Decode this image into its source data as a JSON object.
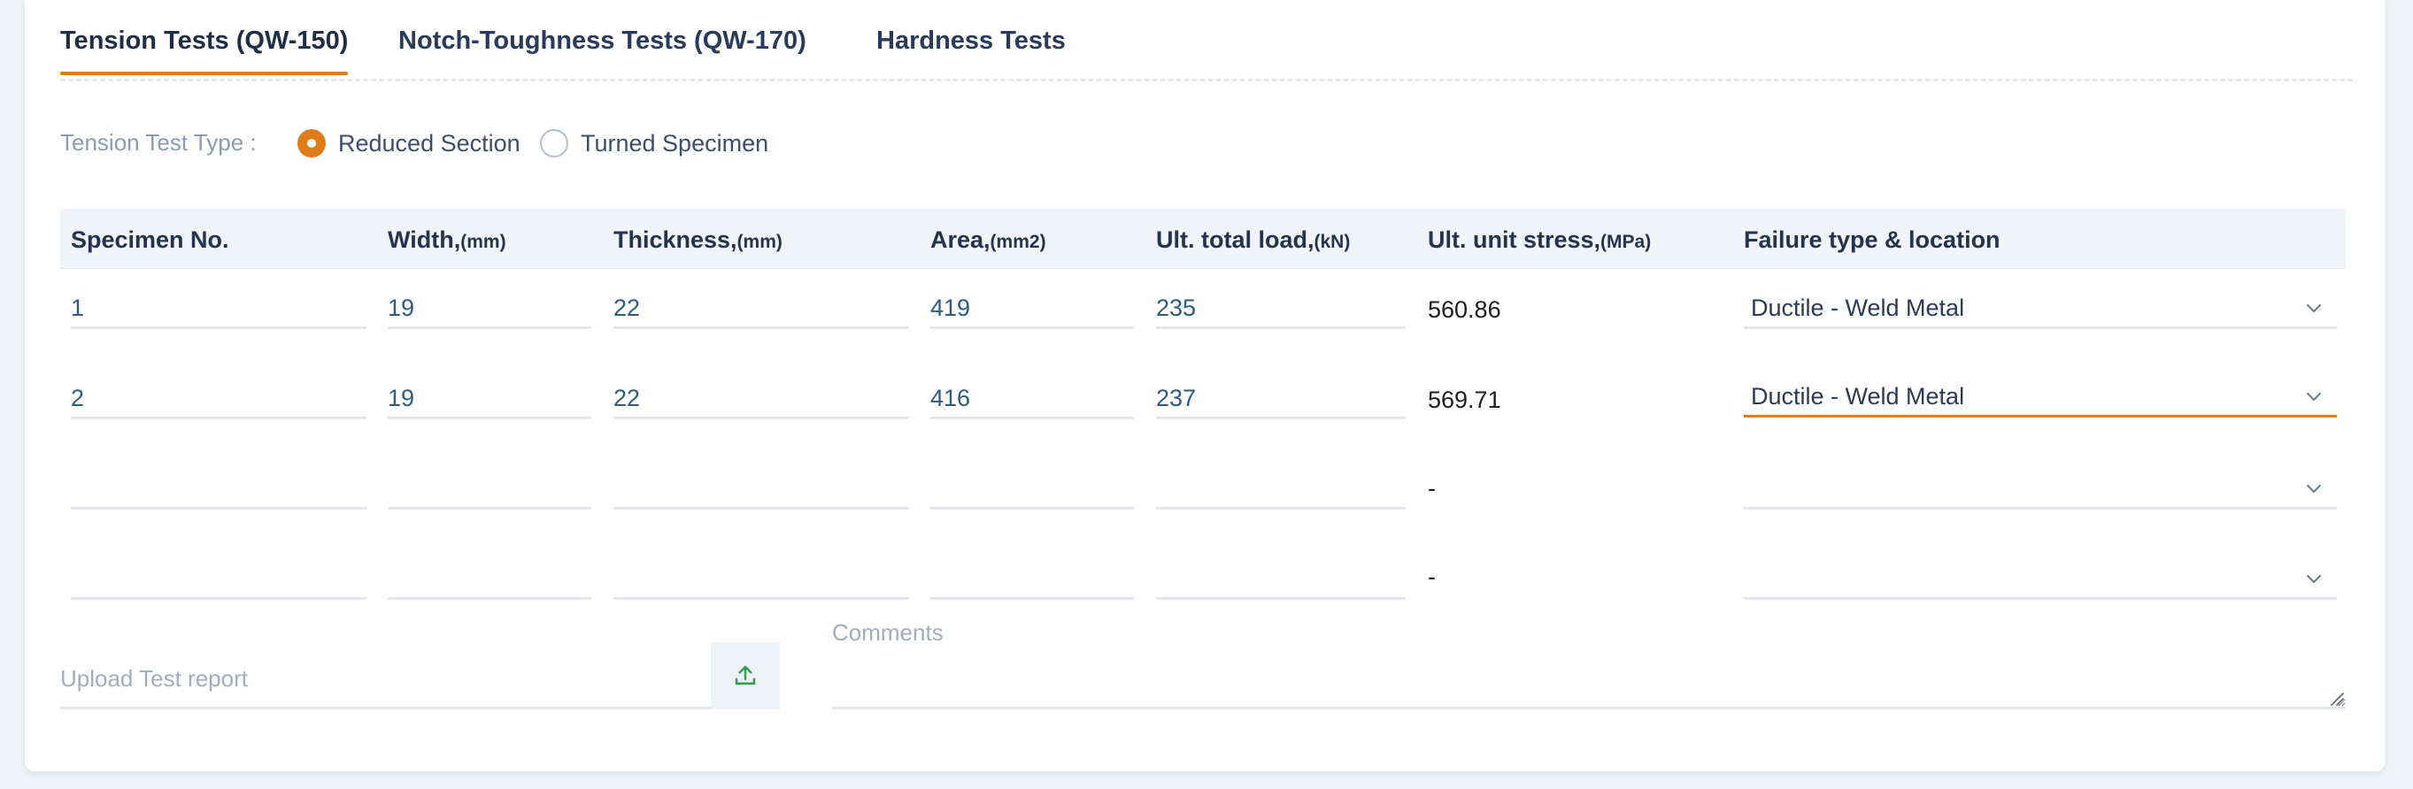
{
  "tabs": [
    {
      "label": "Tension Tests (QW-150)",
      "active": true
    },
    {
      "label": "Notch-Toughness Tests (QW-170)",
      "active": false
    },
    {
      "label": "Hardness Tests",
      "active": false
    }
  ],
  "tension_type": {
    "label": "Tension Test Type :",
    "options": [
      "Reduced Section",
      "Turned Specimen"
    ],
    "selected": "Reduced Section"
  },
  "table": {
    "headers": [
      {
        "title": "Specimen No.",
        "unit": ""
      },
      {
        "title": "Width,",
        "unit": "(mm)"
      },
      {
        "title": "Thickness,",
        "unit": "(mm)"
      },
      {
        "title": "Area,",
        "unit": "(mm2)"
      },
      {
        "title": "Ult. total load,",
        "unit": "(kN)"
      },
      {
        "title": "Ult. unit stress,",
        "unit": "(MPa)"
      },
      {
        "title": "Failure type & location",
        "unit": ""
      }
    ],
    "rows": [
      {
        "specimen": "1",
        "width": "19",
        "thickness": "22",
        "area": "419",
        "load": "235",
        "stress": "560.86",
        "failure": "Ductile - Weld Metal"
      },
      {
        "specimen": "2",
        "width": "19",
        "thickness": "22",
        "area": "416",
        "load": "237",
        "stress": "569.71",
        "failure": "Ductile - Weld Metal"
      },
      {
        "specimen": "",
        "width": "",
        "thickness": "",
        "area": "",
        "load": "",
        "stress": "-",
        "failure": ""
      },
      {
        "specimen": "",
        "width": "",
        "thickness": "",
        "area": "",
        "load": "",
        "stress": "-",
        "failure": ""
      }
    ]
  },
  "upload": {
    "placeholder": "Upload Test report",
    "icon": "upload-icon"
  },
  "comments": {
    "label": "Comments",
    "value": ""
  },
  "colors": {
    "accent": "#e07b1a",
    "upload_icon": "#2e9e4f"
  }
}
